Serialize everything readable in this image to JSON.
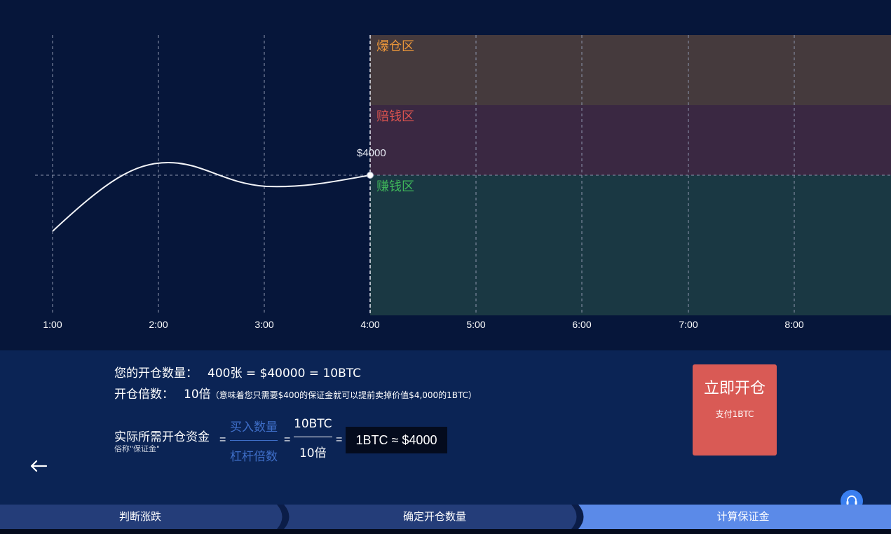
{
  "chart": {
    "price_label": "$4000",
    "zones": [
      {
        "label": "爆仓区",
        "color": "#e8943a"
      },
      {
        "label": "赔钱区",
        "color": "#d9534f"
      },
      {
        "label": "赚钱区",
        "color": "#3fb55a"
      }
    ],
    "x_ticks": [
      "1:00",
      "2:00",
      "3:00",
      "4:00",
      "5:00",
      "6:00",
      "7:00",
      "8:00"
    ]
  },
  "info": {
    "quantity_label": "您的开仓数量：",
    "quantity_value": "400张 = $40000 = 10BTC",
    "leverage_label": "开仓倍数：",
    "leverage_value": "10倍",
    "leverage_note": "（意味着您只需要$400的保证金就可以提前卖掉价值$4,000的1BTC）",
    "formula_title": "实际所需开仓资金",
    "formula_subtitle": "俗称\"保证金\"",
    "eq": "=",
    "frac1_num": "买入数量",
    "frac1_den": "杠杆倍数",
    "frac2_num": "10BTC",
    "frac2_den": "10倍",
    "result": "1BTC ≈ $4000"
  },
  "open_button": {
    "label": "立即开仓",
    "sub_label": "支付1BTC"
  },
  "steps": [
    {
      "label": "判断涨跌"
    },
    {
      "label": "确定开仓数量"
    },
    {
      "label": "计算保证金"
    }
  ],
  "colors": {
    "background": "#06163a",
    "panel": "#0b2455",
    "step_inactive": "#243d79",
    "step_active": "#5b8ae8",
    "button": "#d95a55"
  }
}
